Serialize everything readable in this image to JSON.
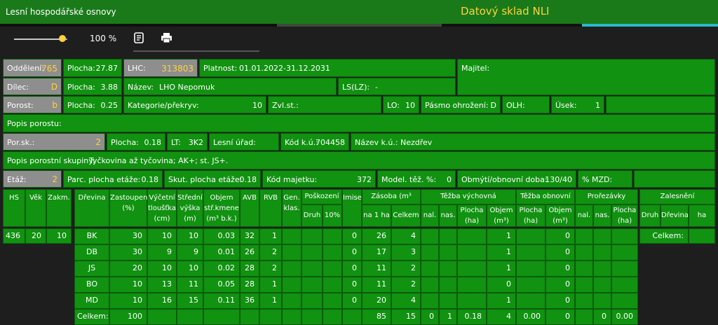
{
  "app": {
    "title": "Lesní hospodářské osnovy",
    "brand": "Datový sklad NLI"
  },
  "toolbar": {
    "zoom": "100 %",
    "zoom_level": 0.9
  },
  "info": {
    "oddeleni_label": "Oddělení:",
    "oddeleni": "765",
    "plocha_label": "Plocha:",
    "plocha1": "27.87",
    "lhc_label": "LHC:",
    "lhc": "313803",
    "platnost_label": "Platnost:",
    "platnost": "01.01.2022-31.12.2031",
    "majitel_label": "Majitel:",
    "dilec_label": "Dílec:",
    "dilec": "D",
    "plocha2": "3.88",
    "nazev_label": "Název:",
    "nazev": "LHO Nepomuk",
    "ls_label": "LS(LZ):",
    "ls": "-",
    "porost_label": "Porost:",
    "porost": "b",
    "plocha3": "0.25",
    "kategorie_label": "Kategorie/překryv:",
    "kategorie": "10",
    "zvlst_label": "Zvl.st.:",
    "lo_label": "LO:",
    "lo": "10",
    "pasmo_label": "Pásmo ohrožení:",
    "pasmo": "D",
    "olh_label": "OLH:",
    "usek_label": "Úsek:",
    "usek": "1",
    "popis_porostu_label": "Popis porostu:",
    "porsk_label": "Por.sk.:",
    "porsk": "2",
    "plocha4": "0.18",
    "lt_label": "LT:",
    "lt": "3K2",
    "lesni_urad_label": "Lesní úřad:",
    "kodku_label": "Kód k.ú.:",
    "kodku": "704458",
    "nazevku_label": "Název k.ú.:",
    "nazevku": "Nezdřev",
    "popis_skupiny_label": "Popis porostní skupiny:",
    "popis_skupiny": "Tyčkovina až tyčovina; AK+; st. JS+.",
    "etaz_label": "Etáž:",
    "etaz": "2",
    "parc_label": "Parc. plocha etáže:",
    "parc": "0.18",
    "skut_label": "Skut. plocha etáže:",
    "skut": "0.18",
    "kod_majetku_label": "Kód majetku:",
    "kod_majetku": "372",
    "model_label": "Model. těž. %:",
    "model": "0",
    "obmyti_label": "Obmýtí/obnovní doba:",
    "obmyti": "130/40",
    "mzd_label": "% MZD:"
  },
  "left_table": {
    "headers": [
      "HS",
      "Věk",
      "Zakm."
    ],
    "row": [
      "436",
      "20",
      "10"
    ]
  },
  "main_table": {
    "h_drevina": "Dřevina",
    "h_zastoupeni": [
      "Zastoupení",
      "(%)"
    ],
    "h_vycetni": [
      "Výčetní",
      "tloušťka",
      "(cm)"
    ],
    "h_stredni": [
      "Střední",
      "výška",
      "(m)"
    ],
    "h_objem": [
      "Objem",
      "stř.kmene",
      "(m³ b.k.)"
    ],
    "h_avb": "AVB",
    "h_rvb": "RVB",
    "h_gen": [
      "Gen.",
      "klas."
    ],
    "h_poskozeni": "Poškození",
    "h_druh": "Druh",
    "h_10": "10%",
    "h_imise": "Imise",
    "h_zasoba": "Zásoba (m³ b.k.)",
    "h_na1ha": "na 1 ha",
    "h_celkem": "Celkem",
    "h_tezba_vych": "Těžba výchovná",
    "h_nal": "nal.",
    "h_nas": "nas.",
    "h_plocha_ha": [
      "Plocha",
      "(ha)"
    ],
    "h_objem_m3": [
      "Objem",
      "(m³)"
    ],
    "h_tezba_obn": "Těžba obnovní",
    "h_prorezavky": "Prořezávky",
    "rows": [
      {
        "dr": "BK",
        "zast": "30",
        "vyc": "10",
        "str": "10",
        "obj": "0.03",
        "avb": "32",
        "rvb": "1",
        "imise": "0",
        "na1ha": "26",
        "celkem": "4",
        "tv_obj": "1",
        "to_obj": "0"
      },
      {
        "dr": "DB",
        "zast": "30",
        "vyc": "9",
        "str": "9",
        "obj": "0.01",
        "avb": "26",
        "rvb": "2",
        "imise": "0",
        "na1ha": "17",
        "celkem": "3",
        "tv_obj": "1",
        "to_obj": "0"
      },
      {
        "dr": "JS",
        "zast": "20",
        "vyc": "10",
        "str": "10",
        "obj": "0.02",
        "avb": "28",
        "rvb": "2",
        "imise": "0",
        "na1ha": "11",
        "celkem": "2",
        "tv_obj": "1",
        "to_obj": "0"
      },
      {
        "dr": "BO",
        "zast": "10",
        "vyc": "13",
        "str": "11",
        "obj": "0.05",
        "avb": "28",
        "rvb": "1",
        "imise": "0",
        "na1ha": "11",
        "celkem": "2",
        "tv_obj": "0",
        "to_obj": "0"
      },
      {
        "dr": "MD",
        "zast": "10",
        "vyc": "16",
        "str": "15",
        "obj": "0.11",
        "avb": "36",
        "rvb": "1",
        "imise": "0",
        "na1ha": "20",
        "celkem": "4",
        "tv_obj": "1",
        "to_obj": "0"
      }
    ],
    "total": {
      "label": "Celkem:",
      "zast": "100",
      "na1ha": "85",
      "celkem": "15",
      "nal": "0",
      "nas": "1",
      "plocha": "0.18",
      "objem": "4",
      "to_plocha": "0.00",
      "to_objem": "0",
      "pr_plocha": "0.00"
    }
  },
  "zalesneni": {
    "title": "Zalesnění",
    "druh": "Druh",
    "drevina": "Dřevina",
    "ha": "ha",
    "celkem": "Celkem:"
  }
}
